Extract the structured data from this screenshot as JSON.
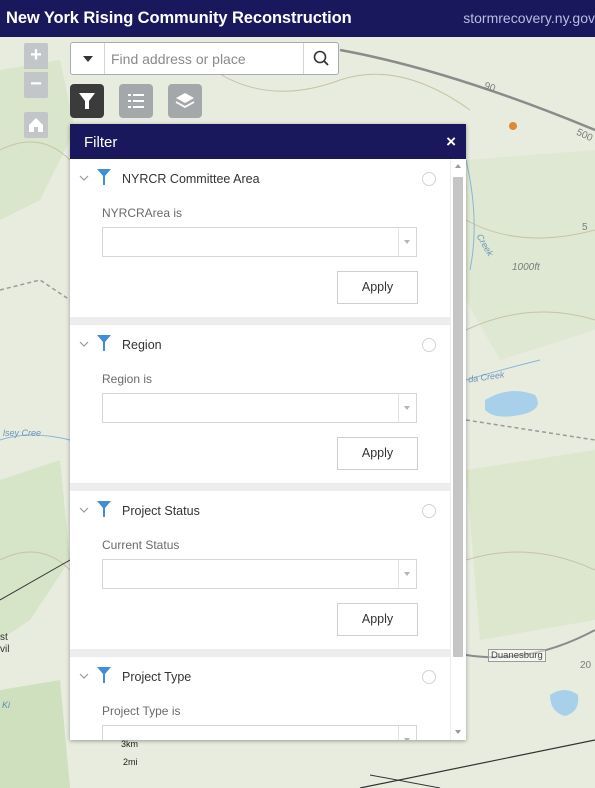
{
  "app": {
    "title": "New York Rising Community Reconstruction",
    "link_text": "stormrecovery.ny.gov"
  },
  "map_controls": {
    "zoom_in": "+",
    "zoom_out": "−"
  },
  "search": {
    "placeholder": "Find address or place"
  },
  "panel": {
    "title": "Filter",
    "close": "×",
    "sections": [
      {
        "title": "NYRCR Committee Area",
        "expression_label": "NYRCRArea is",
        "value": "",
        "apply": "Apply"
      },
      {
        "title": "Region",
        "expression_label": "Region is",
        "value": "",
        "apply": "Apply"
      },
      {
        "title": "Project Status",
        "expression_label": "Current Status",
        "value": "",
        "apply": "Apply"
      },
      {
        "title": "Project Type",
        "expression_label": "Project Type is",
        "value": ""
      }
    ]
  },
  "map_labels": {
    "creek_1": "Creek",
    "creek_2": "da Creek",
    "creek_3": "lsey Cree",
    "contour_1000": "1000ft",
    "road_20": "20",
    "road_90": "90",
    "road_5": "5",
    "road_500": "500",
    "town_duanesburg": "Duanesburg",
    "edge_text_1": "st",
    "edge_text_2": "vil",
    "edge_text_3": "Ki"
  },
  "scale": {
    "km": "3km",
    "mi": "2mi"
  },
  "colors": {
    "header": "#19185d",
    "filter_icon": "#3e8ed8",
    "map_background": "#e9ecdf"
  },
  "icons": {
    "filter_tool": "funnel-icon",
    "legend_tool": "list-icon",
    "layers_tool": "layers-icon",
    "home": "home-icon",
    "search": "search-icon"
  }
}
